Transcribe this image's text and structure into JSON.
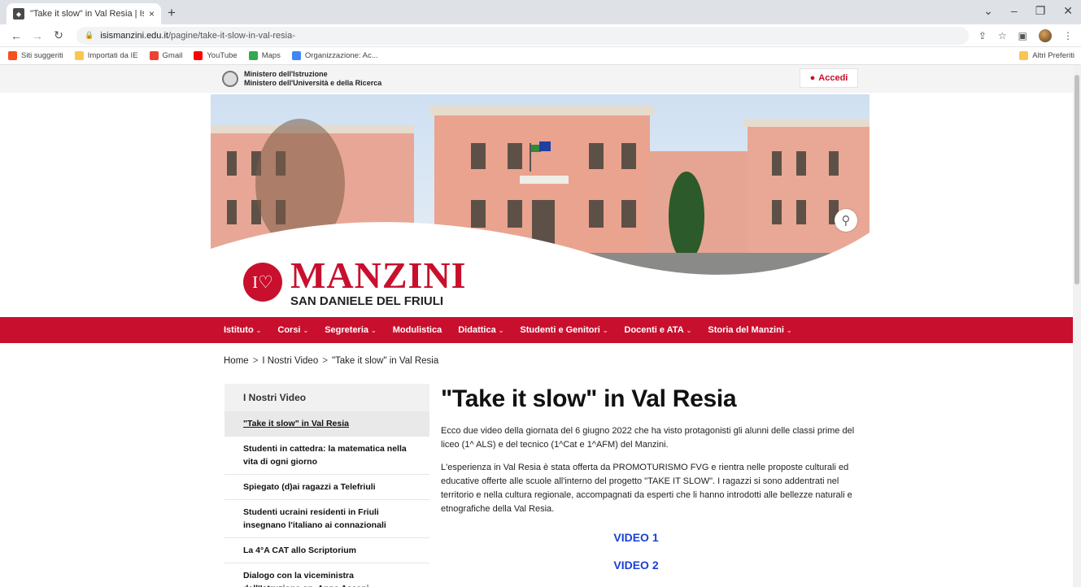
{
  "browser": {
    "tab_title": "\"Take it slow\" in Val Resia | Istitut",
    "tab_close": "×",
    "new_tab": "+",
    "url_host": "isismanzini.edu.it",
    "url_path": "/pagine/take-it-slow-in-val-resia-",
    "bookmarks": [
      {
        "label": "Siti suggeriti",
        "color": "#f4511e"
      },
      {
        "label": "Importati da IE",
        "color": "#f9c74f"
      },
      {
        "label": "Gmail",
        "color": "#ea4335"
      },
      {
        "label": "YouTube",
        "color": "#ff0000"
      },
      {
        "label": "Maps",
        "color": "#34a853"
      },
      {
        "label": "Organizzazione: Ac...",
        "color": "#4285f4"
      }
    ],
    "other_bookmarks": "Altri Preferiti"
  },
  "site": {
    "ministry_line1": "Ministero dell'Istruzione",
    "ministry_line2": "Ministero dell'Università e della Ricerca",
    "login_label": "Accedi",
    "brand_mark": "I♡",
    "brand_name": "MANZINI",
    "brand_city": "SAN DANIELE DEL FRIULI",
    "accent_color": "#c8102e"
  },
  "nav": [
    {
      "label": "Istituto",
      "dropdown": true
    },
    {
      "label": "Corsi",
      "dropdown": true
    },
    {
      "label": "Segreteria",
      "dropdown": true
    },
    {
      "label": "Modulistica",
      "dropdown": false
    },
    {
      "label": "Didattica",
      "dropdown": true
    },
    {
      "label": "Studenti e Genitori",
      "dropdown": true
    },
    {
      "label": "Docenti e ATA",
      "dropdown": true
    },
    {
      "label": "Storia del Manzini",
      "dropdown": true
    }
  ],
  "breadcrumb": [
    "Home",
    "I Nostri Video",
    "\"Take it slow\" in Val Resia"
  ],
  "sidebar": {
    "title": "I Nostri Video",
    "items": [
      "\"Take it slow\" in Val Resia",
      "Studenti in cattedra: la matematica nella vita di ogni giorno",
      "Spiegato (d)ai ragazzi a Telefriuli",
      "Studenti ucraini residenti in Friuli insegnano l'italiano ai connazionali",
      "La 4°A CAT allo Scriptorium",
      "Dialogo con la viceministra dell'Istruzione on. Anna Ascani"
    ]
  },
  "article": {
    "title": "\"Take it slow\" in Val Resia",
    "paragraph1": "Ecco due video della giornata del 6 giugno 2022 che ha visto protagonisti gli alunni delle classi prime del liceo (1^ ALS) e del tecnico (1^Cat e 1^AFM) del Manzini.",
    "paragraph2": "L'esperienza in Val Resia è stata offerta da PROMOTURISMO FVG e rientra nelle proposte culturali ed educative offerte alle scuole all'interno del progetto \"TAKE IT SLOW\". I ragazzi si sono addentrati nel territorio e nella cultura regionale, accompagnati da esperti che li hanno introdotti alle bellezze naturali e etnografiche della Val Resia.",
    "video1": "VIDEO 1",
    "video2": "VIDEO 2"
  }
}
